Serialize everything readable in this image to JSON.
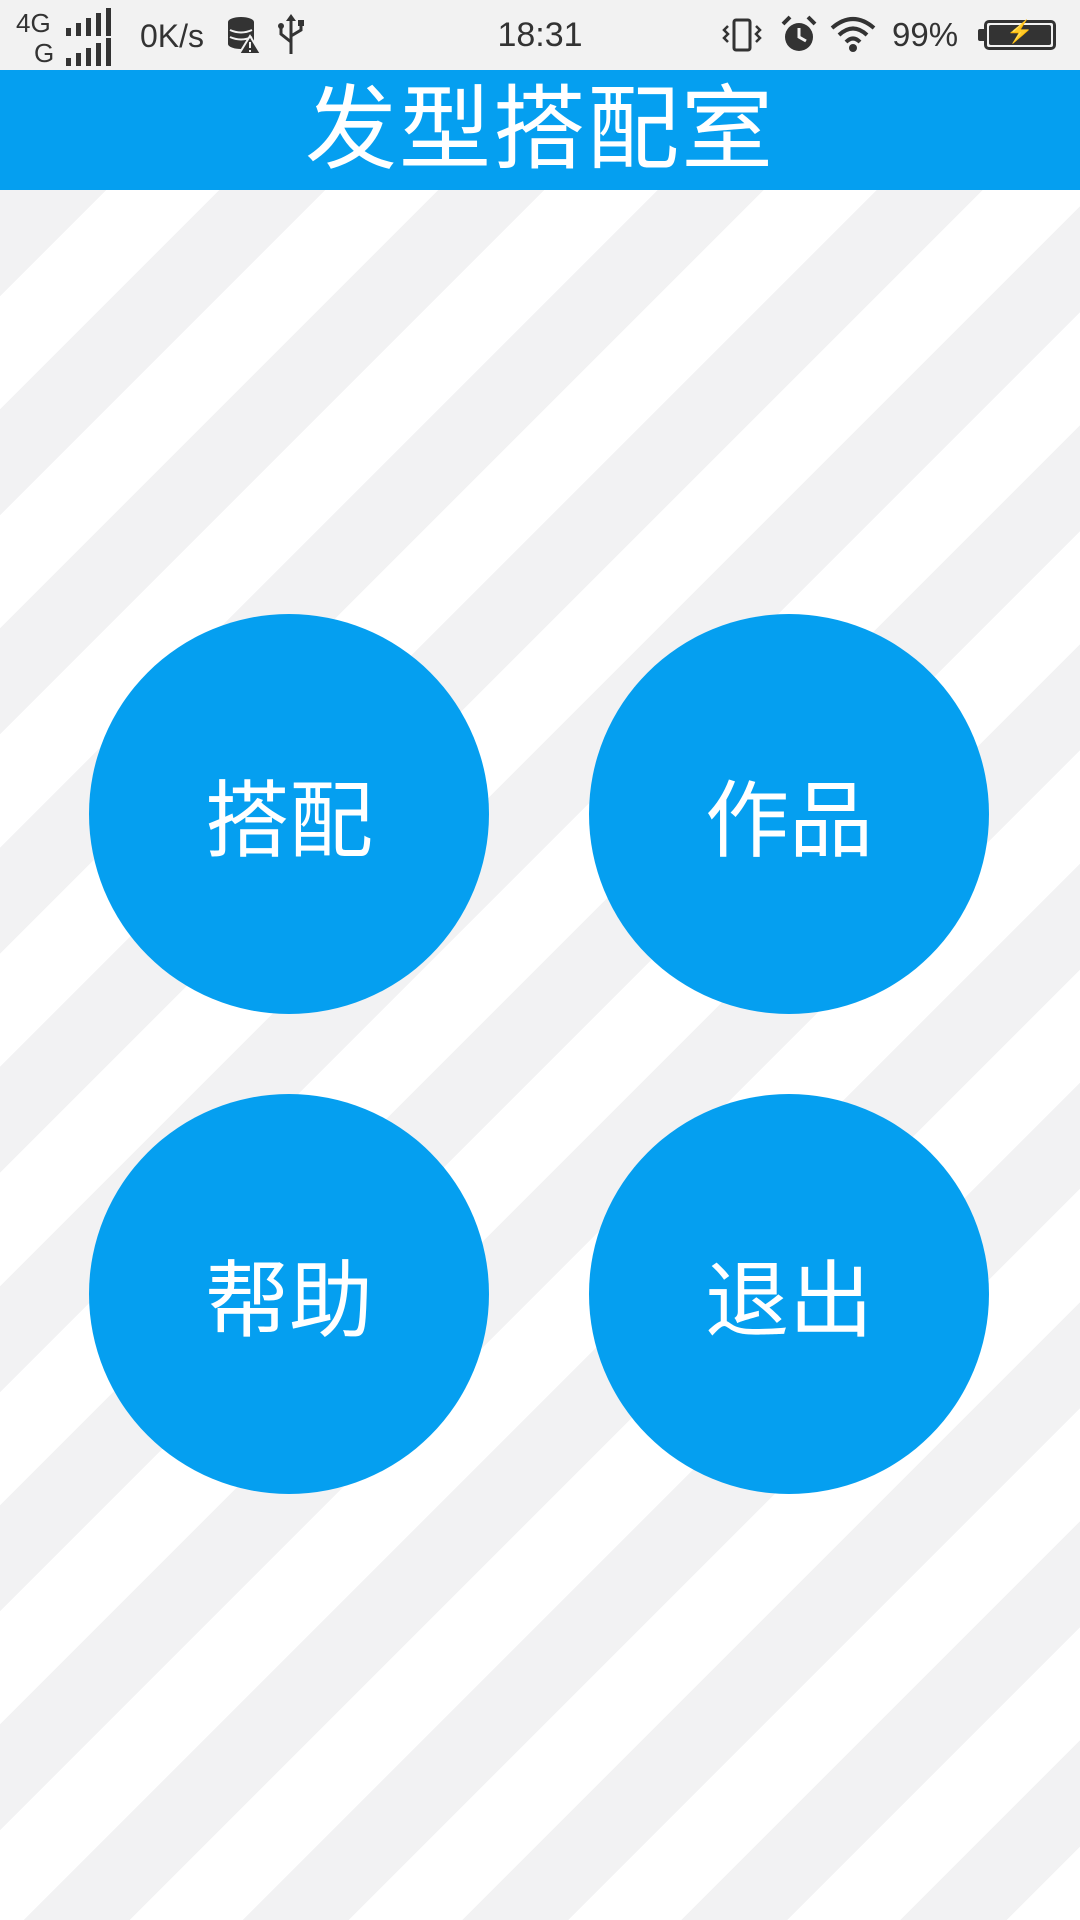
{
  "status_bar": {
    "network_top": "4G",
    "network_bottom": "G",
    "speed": "0K/s",
    "time": "18:31",
    "battery_percent": "99%",
    "icons": [
      "data-warning-icon",
      "usb-icon",
      "vibrate-icon",
      "alarm-icon",
      "wifi-icon",
      "battery-charging-icon"
    ]
  },
  "app_bar": {
    "title": "发型搭配室"
  },
  "menu": {
    "match_label": "搭配",
    "works_label": "作品",
    "help_label": "帮助",
    "exit_label": "退出"
  },
  "colors": {
    "primary": "#059ff0",
    "stripe_gray": "#f2f2f3",
    "stripe_white": "#ffffff",
    "status_bar_bg": "#f2f2f2"
  }
}
